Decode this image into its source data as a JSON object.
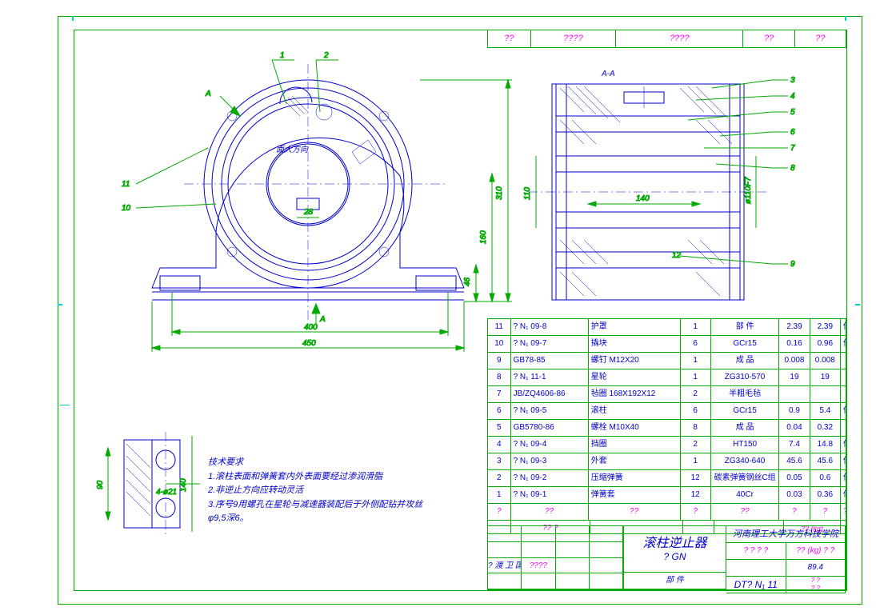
{
  "header": {
    "cells": [
      "??",
      "????",
      "????",
      "??",
      "??"
    ]
  },
  "section_label": "A-A",
  "callouts_top": [
    "1",
    "2"
  ],
  "callouts_left": [
    "11",
    "10"
  ],
  "callouts_right": [
    "3",
    "4",
    "5",
    "6",
    "7",
    "8",
    "9"
  ],
  "arrow_labels": {
    "top": "A",
    "bottom": "A"
  },
  "inner_label": "面大方向",
  "dimensions": {
    "width_base": "400",
    "width_overall": "450",
    "ht_small": "46",
    "ht_mid": "160",
    "ht_large": "310",
    "slot": "28",
    "sec_top": "140",
    "sec_offset": "110",
    "sec_shaft": "ø110F7",
    "sec_gap": "12",
    "det_h": "90",
    "det_w": "140",
    "det_hole": "4-ø21"
  },
  "tech_notes": {
    "title": "技术要求",
    "lines": [
      "1.滚柱表面和弹簧套内外表面要经过渗润滑脂",
      "2.非逆止方向应转动灵活",
      "3.序号9用螺孔在星轮与减速器装配后于外侧配钻并攻丝φ9,5深6。"
    ]
  },
  "bom": {
    "header": [
      "?",
      "??",
      "??",
      "?",
      "??",
      "?",
      "?",
      "??"
    ],
    "header2_left": "?? ?",
    "header2_right": "?? (kg)",
    "rows": [
      {
        "no": "11",
        "code": "? N₁ 09-8",
        "name": "护罩",
        "qty": "1",
        "mat": "部 件",
        "w1": "2.39",
        "w2": "2.39",
        "rem": "借用"
      },
      {
        "no": "10",
        "code": "? N₁ 09-7",
        "name": "撬块",
        "qty": "6",
        "mat": "GCr15",
        "w1": "0.16",
        "w2": "0.96",
        "rem": "借用"
      },
      {
        "no": "9",
        "code": "GB78-85",
        "name": "螺钉 M12X20",
        "qty": "1",
        "mat": "成 品",
        "w1": "0.008",
        "w2": "0.008",
        "rem": ""
      },
      {
        "no": "8",
        "code": "? N₁ 11-1",
        "name": "星轮",
        "qty": "1",
        "mat": "ZG310-570",
        "w1": "19",
        "w2": "19",
        "rem": ""
      },
      {
        "no": "7",
        "code": "JB/ZQ4606-86",
        "name": "毡圈 168X192X12",
        "qty": "2",
        "mat": "半粗毛毡",
        "w1": "",
        "w2": "",
        "rem": ""
      },
      {
        "no": "6",
        "code": "? N₁ 09-5",
        "name": "滚柱",
        "qty": "6",
        "mat": "GCr15",
        "w1": "0.9",
        "w2": "5.4",
        "rem": "借用"
      },
      {
        "no": "5",
        "code": "GB5780-86",
        "name": "螺栓 M10X40",
        "qty": "8",
        "mat": "成 品",
        "w1": "0.04",
        "w2": "0.32",
        "rem": ""
      },
      {
        "no": "4",
        "code": "? N₁ 09-4",
        "name": "挡圈",
        "qty": "2",
        "mat": "HT150",
        "w1": "7.4",
        "w2": "14.8",
        "rem": "借用"
      },
      {
        "no": "3",
        "code": "? N₁ 09-3",
        "name": "外套",
        "qty": "1",
        "mat": "ZG340-640",
        "w1": "45.6",
        "w2": "45.6",
        "rem": "借用"
      },
      {
        "no": "2",
        "code": "? N₁ 09-2",
        "name": "压缩弹簧",
        "qty": "12",
        "mat": "碳素弹簧钢丝C组",
        "w1": "0.05",
        "w2": "0.6",
        "rem": "借用"
      },
      {
        "no": "1",
        "code": "? N₁ 09-1",
        "name": "弹簧套",
        "qty": "12",
        "mat": "40Cr",
        "w1": "0.03",
        "w2": "0.36",
        "rem": "借用"
      }
    ]
  },
  "title_block": {
    "left_cells": [
      "",
      "",
      "",
      "",
      "",
      "",
      "",
      "",
      "? 渡 卫 国",
      "????",
      "",
      "",
      "",
      "",
      "",
      ""
    ],
    "main_title": "滚柱逆止器",
    "sub_title": "? GN",
    "bottom_label": "部 件",
    "org": "河南理工大学万方科技学院",
    "spec_row1": "? ? ? ?",
    "spec_row1b": "?? (kg) ? ?",
    "mass": "89.4",
    "dwg_no": "DT? N₁ 11",
    "scale_hdr": "? ?",
    "scale_val": "? ?"
  }
}
